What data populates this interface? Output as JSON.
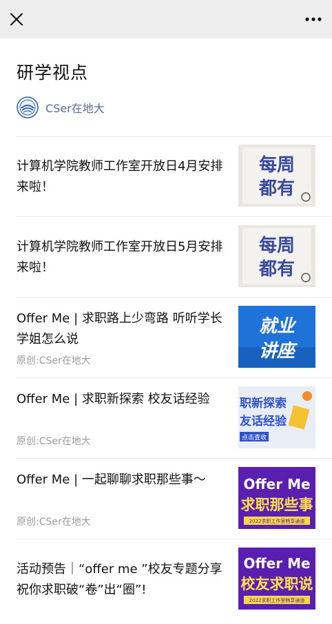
{
  "topbar": {
    "close_icon": "close-icon",
    "more_icon": "more-icon"
  },
  "page": {
    "title": "研学视点"
  },
  "account": {
    "name": "CSer在地大",
    "avatar_icon": "account-logo-icon"
  },
  "articles": [
    {
      "title": "计算机学院教师工作室开放日4月安排来啦！",
      "source": "",
      "thumb_text": [
        "每周",
        "都有"
      ]
    },
    {
      "title": "计算机学院教师工作室开放日5月安排来啦！",
      "source": "",
      "thumb_text": [
        "每周",
        "都有"
      ]
    },
    {
      "title": "Offer Me | 求职路上少弯路 听听学长学姐怎么说",
      "source": "原创:CSer在地大",
      "thumb_text": [
        "就业",
        "讲座"
      ]
    },
    {
      "title": "Offer Me | 求职新探索 校友话经验",
      "source": "原创:CSer在地大",
      "thumb_text": [
        "职新探索",
        "友话经验",
        "点击查收"
      ]
    },
    {
      "title": "Offer Me | 一起聊聊求职那些事～",
      "source": "原创:CSer在地大",
      "thumb_text": [
        "Offer Me",
        "求职那些事",
        "2022求职工作室畅享通道"
      ]
    },
    {
      "title": "活动预告｜“offer me ”校友专题分享祝你求职破“卷”出“圈”!",
      "source": "",
      "thumb_text": [
        "Offer Me",
        "校友求职说",
        "2022求职工作室畅享通道"
      ]
    }
  ],
  "colors": {
    "topbar_bg": "#ededed",
    "link": "#576b95",
    "source_gray": "#9a9a9a"
  }
}
